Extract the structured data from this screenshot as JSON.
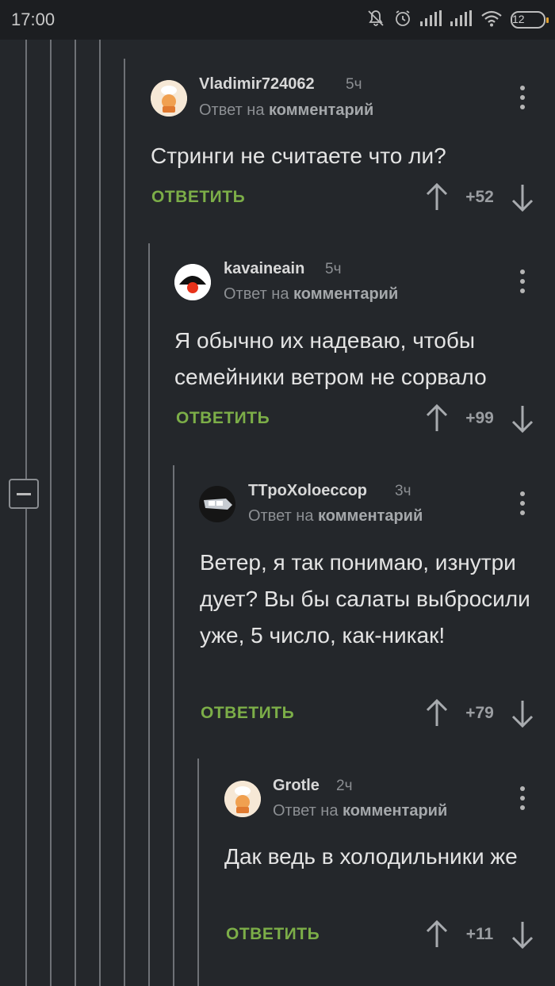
{
  "status_bar": {
    "time": "17:00",
    "battery": "12",
    "icons": [
      "bell-off-icon",
      "alarm-icon",
      "signal-icon",
      "signal-icon",
      "wifi-icon",
      "battery-icon"
    ]
  },
  "comments": [
    {
      "username": "Vladimir724062",
      "time": "5ч",
      "reply_prefix": "Ответ на",
      "reply_target": "комментарий",
      "text": "Стринги не считаете что ли?",
      "reply_label": "ОТВЕТИТЬ",
      "score": "+52",
      "avatar": "chef-avatar"
    },
    {
      "username": "kavaineain",
      "time": "5ч",
      "reply_prefix": "Ответ на",
      "reply_target": "комментарий",
      "text": "Я обычно их надеваю, чтобы семейники ветром не сорвало",
      "reply_label": "ОТВЕТИТЬ",
      "score": "+99",
      "avatar": "umbrella-avatar"
    },
    {
      "username": "TTpoXoloeccop",
      "time": "3ч",
      "reply_prefix": "Ответ на",
      "reply_target": "комментарий",
      "text": "Ветер, я так понимаю, изнутри дует? Вы бы салаты выбросили уже, 5 число, как-никак!",
      "reply_label": "ОТВЕТИТЬ",
      "score": "+79",
      "avatar": "headlight-avatar"
    },
    {
      "username": "Grotle",
      "time": "2ч",
      "reply_prefix": "Ответ на",
      "reply_target": "комментарий",
      "text": "Дак ведь в холодильники же",
      "reply_label": "ОТВЕТИТЬ",
      "score": "+11",
      "avatar": "chef-avatar"
    }
  ],
  "colors": {
    "background": "#24272b",
    "reply_green": "#7cae48",
    "thread_line": "#6e7176"
  }
}
